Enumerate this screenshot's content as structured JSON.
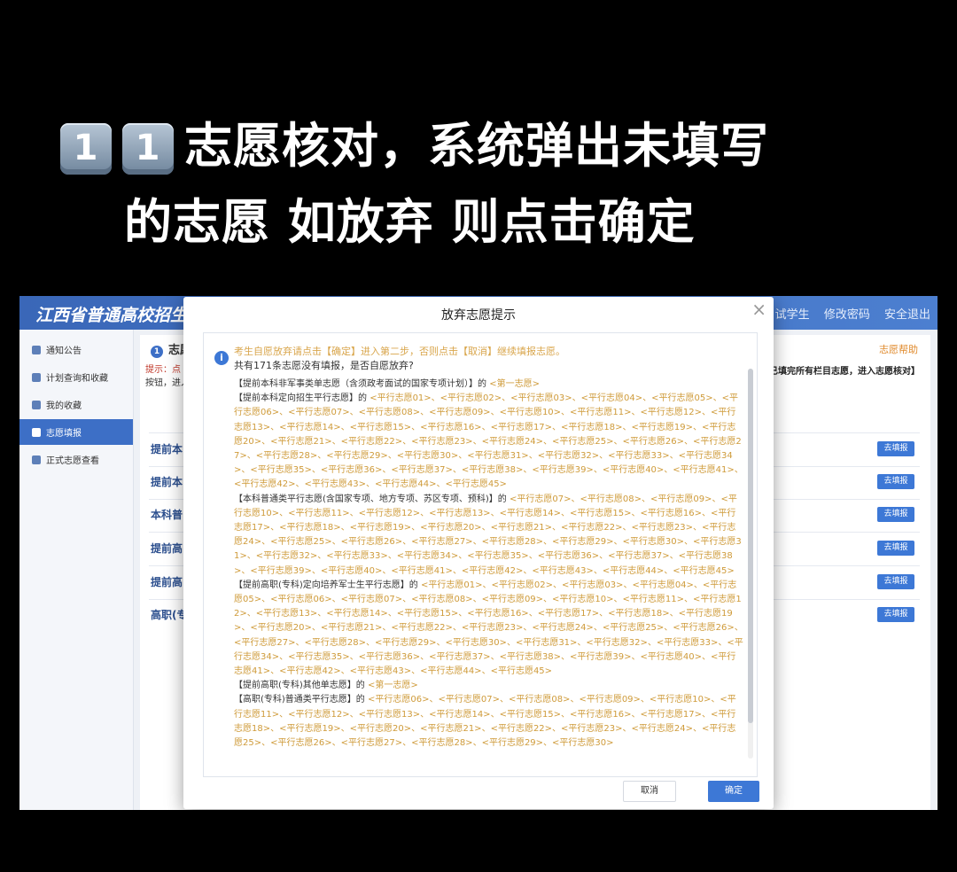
{
  "caption": {
    "keycap1": "1",
    "keycap2": "1",
    "line1": "志愿核对，系统弹出未填写",
    "line2": "的志愿 如放弃 则点击确定"
  },
  "app": {
    "logo": "江西省普通高校招生考",
    "top_links": [
      "试学生",
      "修改密码",
      "安全退出"
    ],
    "sidebar": [
      {
        "label": "通知公告"
      },
      {
        "label": "计划查询和收藏"
      },
      {
        "label": "我的收藏"
      },
      {
        "label": "志愿填报"
      },
      {
        "label": "正式志愿查看"
      }
    ],
    "main_title_num": "1",
    "main_title": "志愿",
    "hint_left": "提示：点",
    "hint_left2": "按钮，进入",
    "hint_right": "已填完所有栏目志愿，进入志愿核对】",
    "help": "志愿帮助",
    "rows": [
      "提前本",
      "提前本",
      "本科普",
      "提前高",
      "提前高",
      "高职(专"
    ],
    "fill_label": "去填报",
    "colors": {
      "accent": "#3d78d6",
      "orange": "#cf9b3a"
    }
  },
  "dialog": {
    "title": "放弃志愿提示",
    "note": "考生自愿放弃请点击【确定】进入第二步，否则点击【取消】继续填报志愿。",
    "question": "共有171条志愿没有填报，是否自愿放弃?",
    "groups": [
      {
        "cat": "【提前本科非军事类单志愿（含须政考面试的国家专项计划）】的",
        "items": [
          "<第一志愿>"
        ]
      },
      {
        "cat": "【提前本科定向招生平行志愿】的",
        "items": [
          "<平行志愿01>",
          "<平行志愿02>",
          "<平行志愿03>",
          "<平行志愿04>",
          "<平行志愿05>",
          "<平行志愿06>",
          "<平行志愿07>",
          "<平行志愿08>",
          "<平行志愿09>",
          "<平行志愿10>",
          "<平行志愿11>",
          "<平行志愿12>",
          "<平行志愿13>",
          "<平行志愿14>",
          "<平行志愿15>",
          "<平行志愿16>",
          "<平行志愿17>",
          "<平行志愿18>",
          "<平行志愿19>",
          "<平行志愿20>",
          "<平行志愿21>",
          "<平行志愿22>",
          "<平行志愿23>",
          "<平行志愿24>",
          "<平行志愿25>",
          "<平行志愿26>",
          "<平行志愿27>",
          "<平行志愿28>",
          "<平行志愿29>",
          "<平行志愿30>",
          "<平行志愿31>",
          "<平行志愿32>",
          "<平行志愿33>",
          "<平行志愿34>",
          "<平行志愿35>",
          "<平行志愿36>",
          "<平行志愿37>",
          "<平行志愿38>",
          "<平行志愿39>",
          "<平行志愿40>",
          "<平行志愿41>",
          "<平行志愿42>",
          "<平行志愿43>",
          "<平行志愿44>",
          "<平行志愿45>"
        ]
      },
      {
        "cat": "【本科普通类平行志愿(含国家专项、地方专项、苏区专项、预科)】的",
        "items": [
          "<平行志愿07>",
          "<平行志愿08>",
          "<平行志愿09>",
          "<平行志愿10>",
          "<平行志愿11>",
          "<平行志愿12>",
          "<平行志愿13>",
          "<平行志愿14>",
          "<平行志愿15>",
          "<平行志愿16>",
          "<平行志愿17>",
          "<平行志愿18>",
          "<平行志愿19>",
          "<平行志愿20>",
          "<平行志愿21>",
          "<平行志愿22>",
          "<平行志愿23>",
          "<平行志愿24>",
          "<平行志愿25>",
          "<平行志愿26>",
          "<平行志愿27>",
          "<平行志愿28>",
          "<平行志愿29>",
          "<平行志愿30>",
          "<平行志愿31>",
          "<平行志愿32>",
          "<平行志愿33>",
          "<平行志愿34>",
          "<平行志愿35>",
          "<平行志愿36>",
          "<平行志愿37>",
          "<平行志愿38>",
          "<平行志愿39>",
          "<平行志愿40>",
          "<平行志愿41>",
          "<平行志愿42>",
          "<平行志愿43>",
          "<平行志愿44>",
          "<平行志愿45>"
        ]
      },
      {
        "cat": "【提前高职(专科)定向培养军士生平行志愿】的",
        "items": [
          "<平行志愿01>",
          "<平行志愿02>",
          "<平行志愿03>",
          "<平行志愿04>",
          "<平行志愿05>",
          "<平行志愿06>",
          "<平行志愿07>",
          "<平行志愿08>",
          "<平行志愿09>",
          "<平行志愿10>",
          "<平行志愿11>",
          "<平行志愿12>",
          "<平行志愿13>",
          "<平行志愿14>",
          "<平行志愿15>",
          "<平行志愿16>",
          "<平行志愿17>",
          "<平行志愿18>",
          "<平行志愿19>",
          "<平行志愿20>",
          "<平行志愿21>",
          "<平行志愿22>",
          "<平行志愿23>",
          "<平行志愿24>",
          "<平行志愿25>",
          "<平行志愿26>",
          "<平行志愿27>",
          "<平行志愿28>",
          "<平行志愿29>",
          "<平行志愿30>",
          "<平行志愿31>",
          "<平行志愿32>",
          "<平行志愿33>",
          "<平行志愿34>",
          "<平行志愿35>",
          "<平行志愿36>",
          "<平行志愿37>",
          "<平行志愿38>",
          "<平行志愿39>",
          "<平行志愿40>",
          "<平行志愿41>",
          "<平行志愿42>",
          "<平行志愿43>",
          "<平行志愿44>",
          "<平行志愿45>"
        ]
      },
      {
        "cat": "【提前高职(专科)其他单志愿】的",
        "items": [
          "<第一志愿>"
        ]
      },
      {
        "cat": "【高职(专科)普通类平行志愿】的",
        "items": [
          "<平行志愿06>",
          "<平行志愿07>",
          "<平行志愿08>",
          "<平行志愿09>",
          "<平行志愿10>",
          "<平行志愿11>",
          "<平行志愿12>",
          "<平行志愿13>",
          "<平行志愿14>",
          "<平行志愿15>",
          "<平行志愿16>",
          "<平行志愿17>",
          "<平行志愿18>",
          "<平行志愿19>",
          "<平行志愿20>",
          "<平行志愿21>",
          "<平行志愿22>",
          "<平行志愿23>",
          "<平行志愿24>",
          "<平行志愿25>",
          "<平行志愿26>",
          "<平行志愿27>",
          "<平行志愿28>",
          "<平行志愿29>",
          "<平行志愿30>"
        ]
      }
    ],
    "cancel": "取消",
    "ok": "确定"
  }
}
